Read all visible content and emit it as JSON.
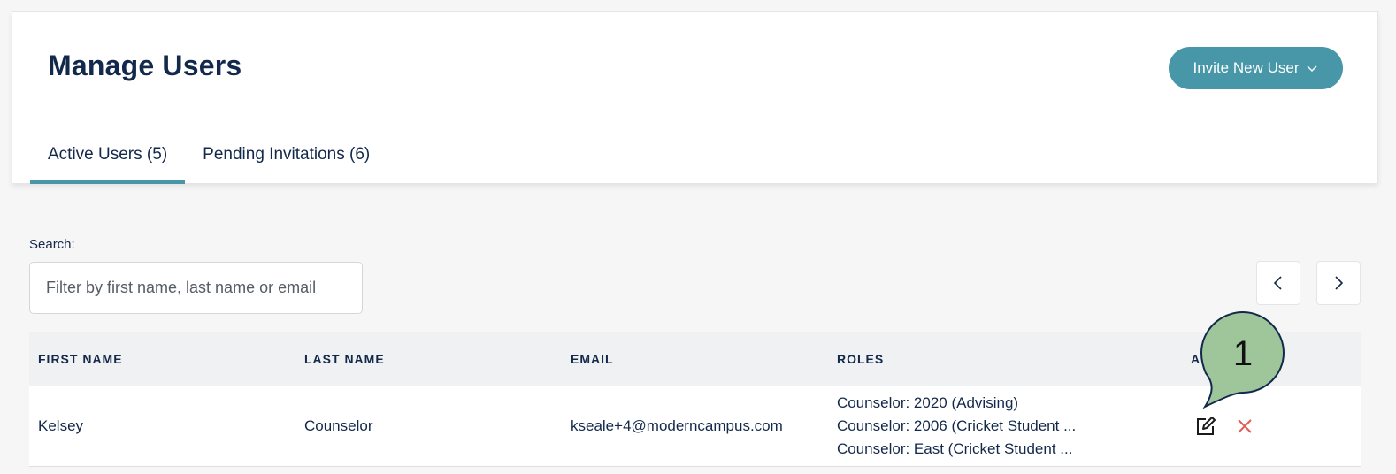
{
  "header": {
    "title": "Manage Users",
    "invite_label": "Invite New User"
  },
  "tabs": [
    {
      "label": "Active Users",
      "count": "(5)"
    },
    {
      "label": "Pending Invitations",
      "count": "(6)"
    }
  ],
  "search": {
    "label": "Search:",
    "placeholder": "Filter by first name, last name or email"
  },
  "table": {
    "headers": [
      "FIRST NAME",
      "LAST NAME",
      "EMAIL",
      "ROLES",
      "A"
    ],
    "rows": [
      {
        "first_name": "Kelsey",
        "last_name": "Counselor",
        "email": "kseale+4@moderncampus.com",
        "roles": [
          "Counselor: 2020 (Advising)",
          "Counselor: 2006 (Cricket Student ...",
          "Counselor: East (Cricket Student ..."
        ]
      }
    ]
  },
  "callout": {
    "number": "1"
  },
  "icons": {
    "invite_dropdown": "chevron-down-icon",
    "prev": "chevron-left-icon",
    "next": "chevron-right-icon",
    "edit": "edit-icon",
    "delete": "close-icon"
  },
  "colors": {
    "accent": "#4797a8",
    "title": "#13294b",
    "delete": "#e25c55",
    "callout": "#9ec69a"
  }
}
